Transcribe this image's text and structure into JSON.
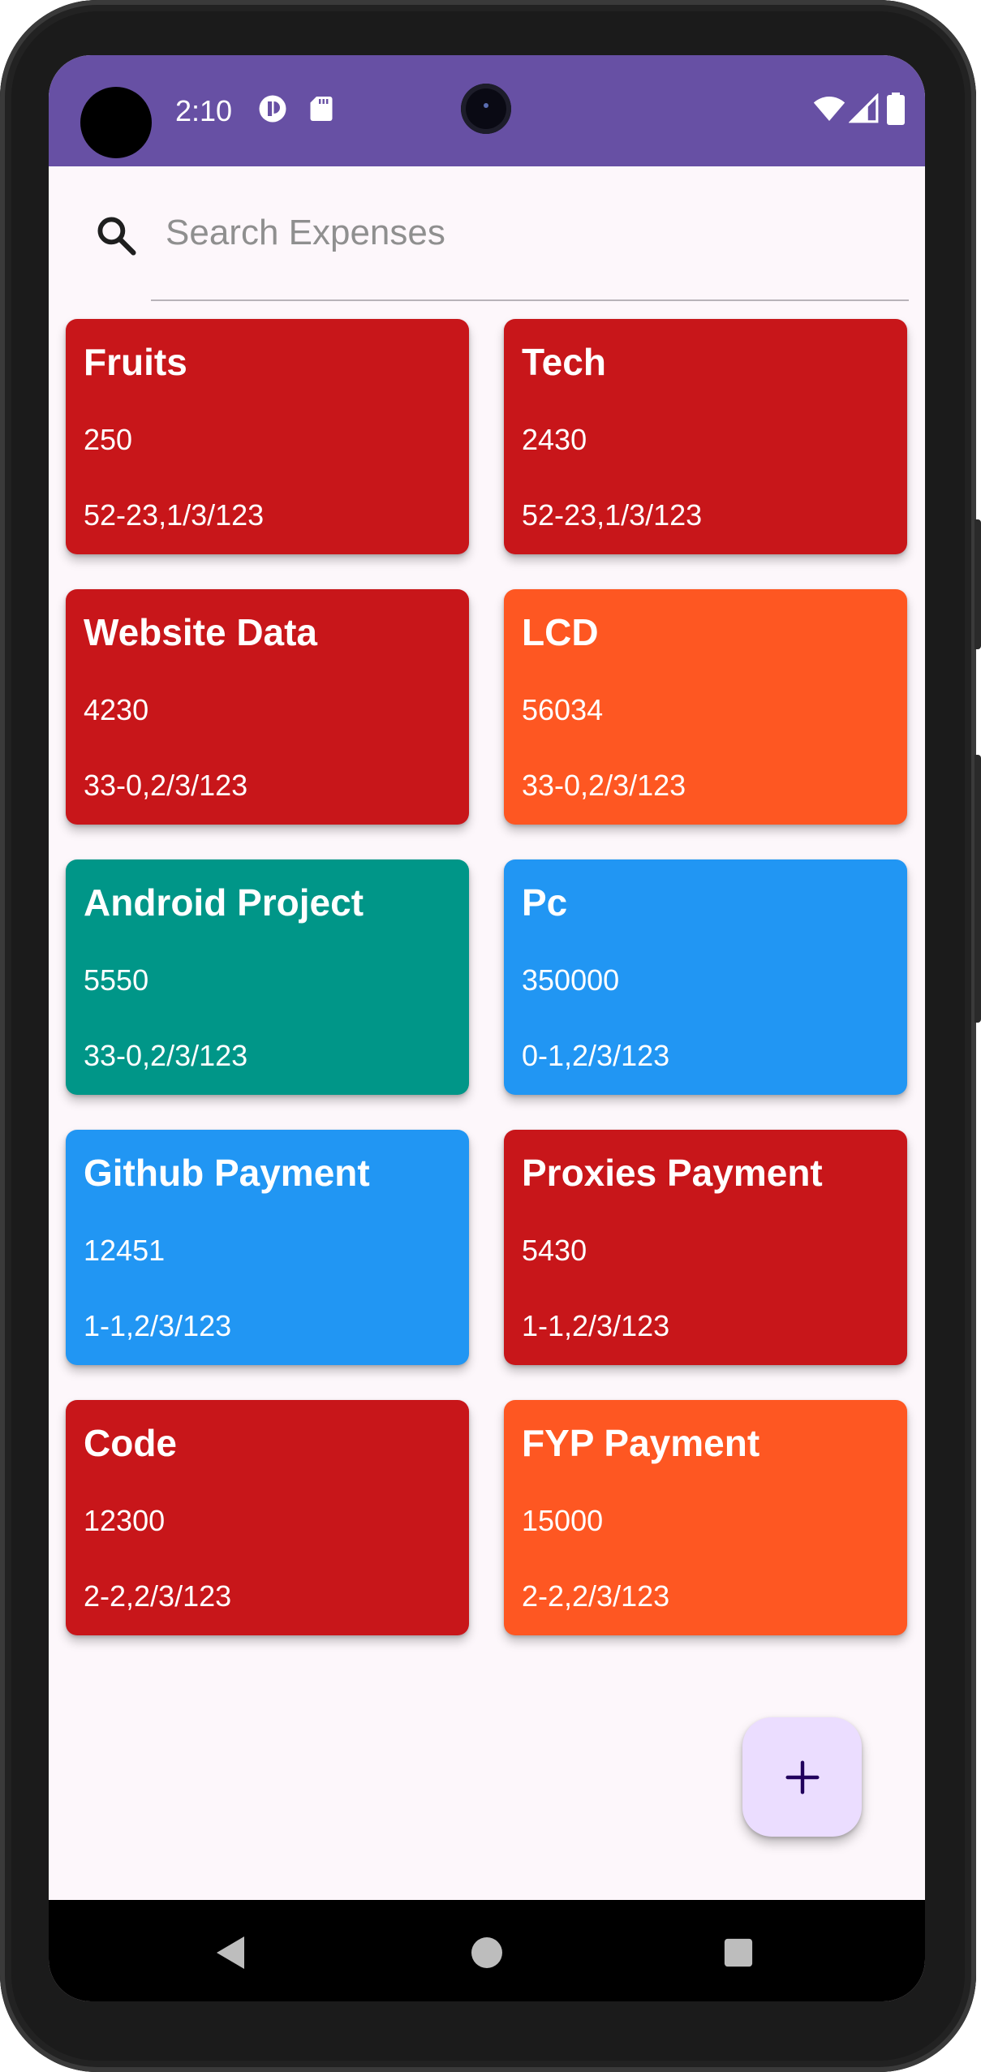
{
  "status_bar": {
    "time": "2:10",
    "color": "#6750a4",
    "icons": [
      "app-notification-icon",
      "sd-card-icon",
      "wifi-icon",
      "cellular-signal-icon",
      "battery-icon"
    ]
  },
  "search": {
    "placeholder": "Search Expenses",
    "value": "",
    "icon": "search-icon"
  },
  "expenses": [
    {
      "title": "Fruits",
      "amount": "250",
      "date": "52-23,1/3/123",
      "color": "#c8161a"
    },
    {
      "title": "Tech",
      "amount": "2430",
      "date": "52-23,1/3/123",
      "color": "#c8161a"
    },
    {
      "title": "Website Data",
      "amount": "4230",
      "date": "33-0,2/3/123",
      "color": "#c8161a"
    },
    {
      "title": "LCD",
      "amount": "56034",
      "date": "33-0,2/3/123",
      "color": "#fe5722"
    },
    {
      "title": "Android Project",
      "amount": "5550",
      "date": "33-0,2/3/123",
      "color": "#009688"
    },
    {
      "title": "Pc",
      "amount": "350000",
      "date": "0-1,2/3/123",
      "color": "#2196f3"
    },
    {
      "title": "Github Payment",
      "amount": "12451",
      "date": "1-1,2/3/123",
      "color": "#2196f3"
    },
    {
      "title": "Proxies Payment",
      "amount": "5430",
      "date": "1-1,2/3/123",
      "color": "#c8161a"
    },
    {
      "title": "Code",
      "amount": "12300",
      "date": "2-2,2/3/123",
      "color": "#c8161a"
    },
    {
      "title": "FYP Payment",
      "amount": "15000",
      "date": "2-2,2/3/123",
      "color": "#fe5722"
    }
  ],
  "fab": {
    "icon": "plus-icon",
    "color": "#ebddff",
    "icon_color": "#21005d"
  },
  "nav_bar": {
    "buttons": [
      "back-icon",
      "home-icon",
      "recents-icon"
    ]
  }
}
